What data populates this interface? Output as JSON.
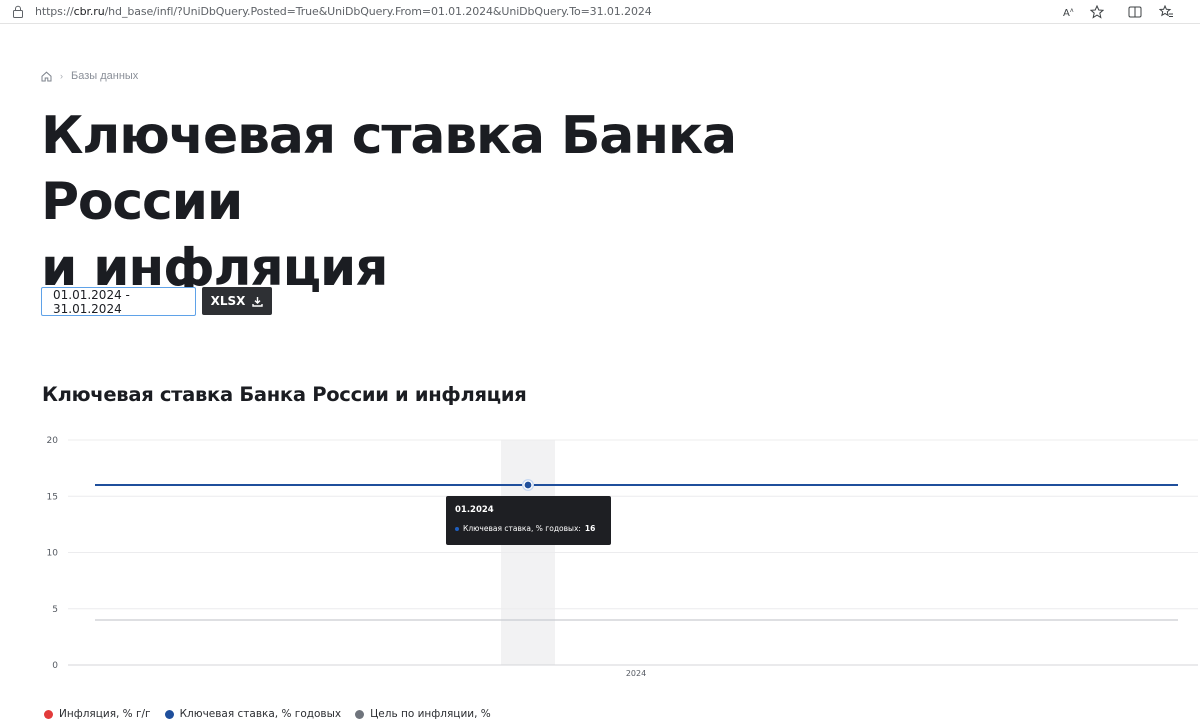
{
  "browser": {
    "url_prefix": "https://",
    "url_host": "cbr.ru",
    "url_path": "/hd_base/infl/?UniDbQuery.Posted=True&UniDbQuery.From=01.01.2024&UniDbQuery.To=31.01.2024"
  },
  "breadcrumb": {
    "item": "Базы данных"
  },
  "page": {
    "title_line1": "Ключевая ставка Банка России",
    "title_line2": "и инфляция"
  },
  "controls": {
    "date_range": "01.01.2024 - 31.01.2024",
    "xlsx_label": "XLSX"
  },
  "chart_heading": "Ключевая ставка Банка России и инфляция",
  "tooltip": {
    "date": "01.2024",
    "series_label": "Ключевая ставка, % годовых:",
    "value": "16"
  },
  "legend": [
    {
      "label": "Инфляция, % г/г",
      "color": "#e23b3b"
    },
    {
      "label": "Ключевая ставка, % годовых",
      "color": "#1f4f9c"
    },
    {
      "label": "Цель по инфляции, %",
      "color": "#6f747c"
    }
  ],
  "chart_data": {
    "type": "line",
    "x": [
      "01.2024"
    ],
    "x_tick_label": "2024",
    "y_ticks": [
      0,
      5,
      10,
      15,
      20
    ],
    "ylim": [
      0,
      20
    ],
    "grid": true,
    "hover_x": "01.2024",
    "series": [
      {
        "name": "Ключевая ставка, % годовых",
        "values": [
          16
        ],
        "color": "#1f4f9c"
      },
      {
        "name": "Цель по инфляции, %",
        "values": [
          4
        ],
        "color": "#c9ccd1"
      }
    ],
    "legend_position": "bottom"
  }
}
